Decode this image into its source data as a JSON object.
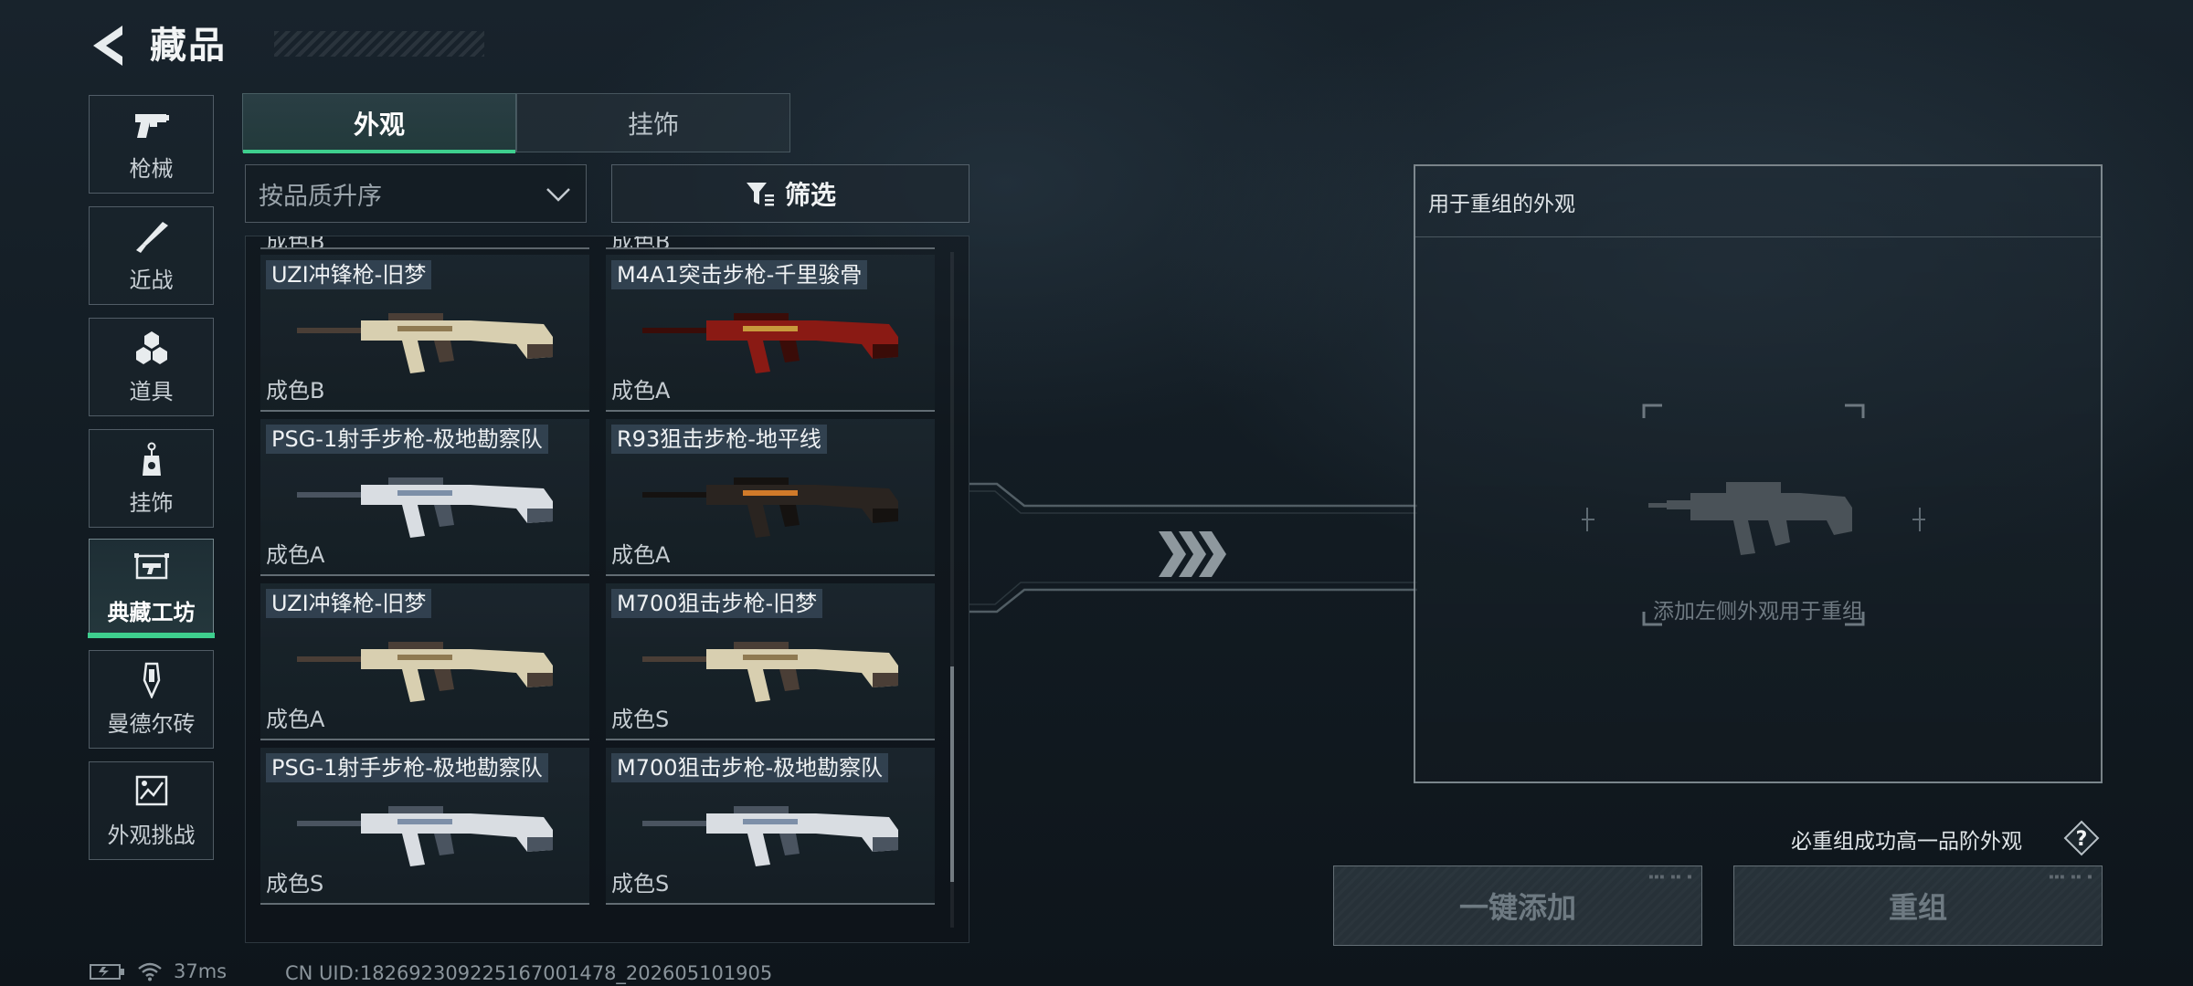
{
  "header": {
    "title": "藏品"
  },
  "sidebar": {
    "items": [
      {
        "label": "枪械",
        "icon": "pistol-icon"
      },
      {
        "label": "近战",
        "icon": "knife-icon"
      },
      {
        "label": "道具",
        "icon": "items-icon"
      },
      {
        "label": "挂饰",
        "icon": "charm-icon"
      },
      {
        "label": "典藏工坊",
        "icon": "workshop-icon",
        "active": true
      },
      {
        "label": "曼德尔砖",
        "icon": "mandel-brick-icon"
      },
      {
        "label": "外观挑战",
        "icon": "challenge-icon"
      }
    ]
  },
  "tabs": [
    {
      "label": "外观",
      "active": true
    },
    {
      "label": "挂饰",
      "active": false
    }
  ],
  "sort": {
    "value": "按品质升序"
  },
  "filter": {
    "label": "筛选"
  },
  "grid": {
    "partial_row": [
      "成色B",
      "成色B"
    ],
    "cards": [
      {
        "name": "UZI冲锋枪-旧梦",
        "grade": "成色B",
        "skin": "ivory"
      },
      {
        "name": "M4A1突击步枪-千里骏骨",
        "grade": "成色A",
        "skin": "crimson"
      },
      {
        "name": "PSG-1射手步枪-极地勘察队",
        "grade": "成色A",
        "skin": "arctic"
      },
      {
        "name": "R93狙击步枪-地平线",
        "grade": "成色A",
        "skin": "horizon"
      },
      {
        "name": "UZI冲锋枪-旧梦",
        "grade": "成色A",
        "skin": "ivory"
      },
      {
        "name": "M700狙击步枪-旧梦",
        "grade": "成色S",
        "skin": "ivory"
      },
      {
        "name": "PSG-1射手步枪-极地勘察队",
        "grade": "成色S",
        "skin": "arctic"
      },
      {
        "name": "M700狙击步枪-极地勘察队",
        "grade": "成色S",
        "skin": "arctic"
      }
    ]
  },
  "target": {
    "header": "用于重组的外观",
    "hint": "添加左侧外观用于重组"
  },
  "guarantee_text": "必重组成功高一品阶外观",
  "buttons": {
    "add": "一键添加",
    "recombine": "重组"
  },
  "status": {
    "ping": "37ms",
    "uid": "CN UID:182692309225167001478_202605101905"
  },
  "colors": {
    "accent": "#3ecf8e",
    "background": "#141e25"
  }
}
